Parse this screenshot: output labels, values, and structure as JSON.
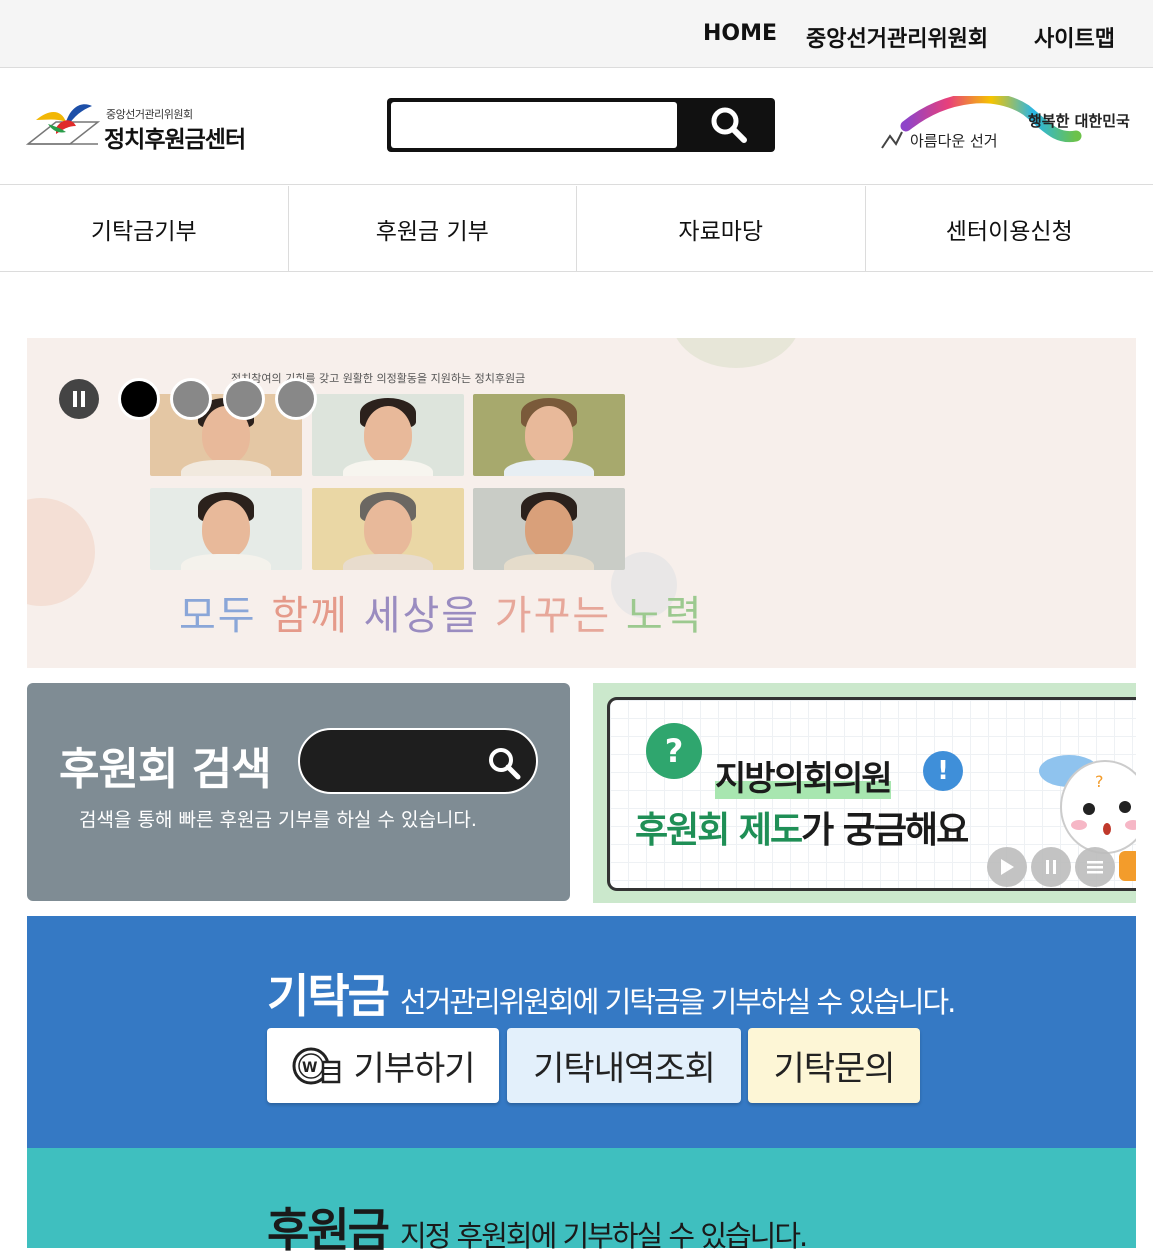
{
  "utility_nav": [
    "HOME",
    "중앙선거관리위원회",
    "사이트맵"
  ],
  "logo": {
    "org": "중앙선거관리위원회",
    "name": "정치후원금센터"
  },
  "search": {
    "placeholder": "",
    "button_icon": "search-icon"
  },
  "slogan": {
    "left": "아름다운 선거",
    "right": "행복한 대한민국"
  },
  "main_nav": [
    "기탁금기부",
    "후원금 기부",
    "자료마당",
    "센터이용신청"
  ],
  "hero": {
    "tagline": "정치참여의 기회를 갖고 원활한 의정활동을 지원하는 정치후원금",
    "slogan_parts": [
      {
        "text": "모두 ",
        "color": "#8aa6d8"
      },
      {
        "text": "함께",
        "color": "#e59a8a"
      },
      {
        "text": " 세상을 ",
        "color": "#9a8cc0"
      },
      {
        "text": "가꾸는 ",
        "color": "#e7a79a"
      },
      {
        "text": "노력",
        "color": "#9cc98f"
      }
    ],
    "slider_dots": 4,
    "active_dot": 0
  },
  "search_panel": {
    "title": "후원회 검색",
    "placeholder": "",
    "description": "검색을 통해 빠른 후원금 기부를 하실 수 있습니다."
  },
  "promo": {
    "line1_highlight": "지방의회의원",
    "line2_green": "후원회 제도",
    "line2_rest": "가 궁금해요",
    "controls": [
      "play-icon",
      "pause-icon",
      "menu-icon"
    ]
  },
  "deposit": {
    "title": "기탁금",
    "subtitle": "선거관리위원회에 기탁금을 기부하실 수 있습니다.",
    "buttons": [
      {
        "label": "기부하기",
        "bg": "#ffffff"
      },
      {
        "label": "기탁내역조회",
        "bg": "#e3f0fb"
      },
      {
        "label": "기탁문의",
        "bg": "#fdf6d6"
      }
    ]
  },
  "support": {
    "title": "후원금",
    "subtitle": "지정 후원회에 기부하실 수 있습니다."
  },
  "colors": {
    "deposit_band": "#3579c4",
    "support_band": "#3fbfbf",
    "search_panel": "#7f8c94"
  }
}
